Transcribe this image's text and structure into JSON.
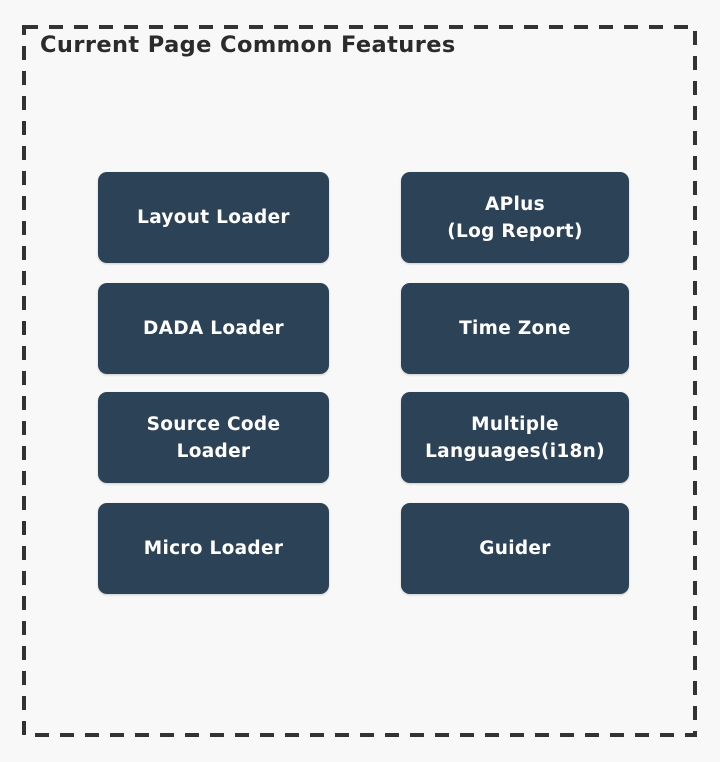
{
  "diagram": {
    "title": "Current Page Common Features",
    "border_style": "dashed",
    "border_color": "#333333",
    "background_color": "#f8f8f8",
    "box_color": "#2c4257",
    "box_text_color": "#ffffff",
    "columns": 2,
    "rows": 4,
    "features": [
      {
        "id": "layout-loader",
        "label": "Layout Loader",
        "column": "left",
        "row": 0
      },
      {
        "id": "aplus-log-report",
        "label": "APlus\n(Log Report)",
        "column": "right",
        "row": 0
      },
      {
        "id": "dada-loader",
        "label": "DADA Loader",
        "column": "left",
        "row": 1
      },
      {
        "id": "time-zone",
        "label": "Time Zone",
        "column": "right",
        "row": 1
      },
      {
        "id": "source-code-loader",
        "label": "Source Code\nLoader",
        "column": "left",
        "row": 2
      },
      {
        "id": "multiple-languages",
        "label": "Multiple\nLanguages(i18n)",
        "column": "right",
        "row": 2
      },
      {
        "id": "micro-loader",
        "label": "Micro Loader",
        "column": "left",
        "row": 3
      },
      {
        "id": "guider",
        "label": "Guider",
        "column": "right",
        "row": 3
      }
    ]
  }
}
